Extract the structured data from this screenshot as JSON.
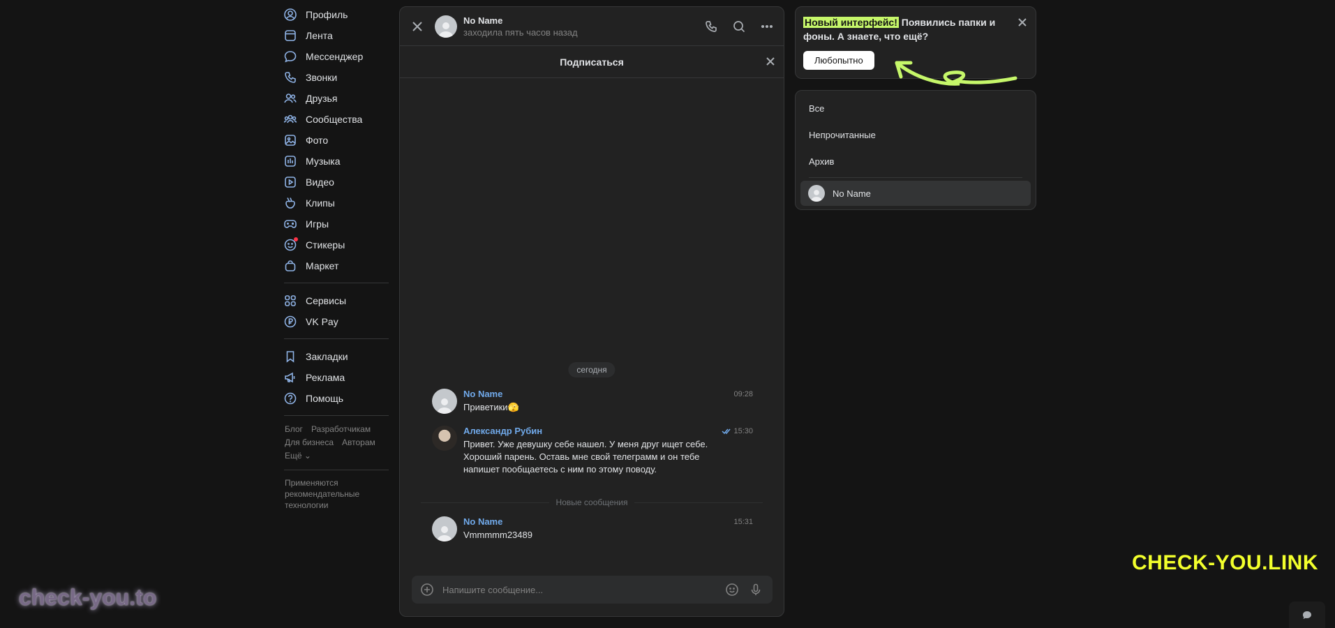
{
  "nav": {
    "primary": [
      {
        "id": "profile",
        "label": "Профиль",
        "icon": "user-circle-icon"
      },
      {
        "id": "feed",
        "label": "Лента",
        "icon": "feed-icon"
      },
      {
        "id": "messenger",
        "label": "Мессенджер",
        "icon": "chat-bubble-icon"
      },
      {
        "id": "calls",
        "label": "Звонки",
        "icon": "phone-icon"
      },
      {
        "id": "friends",
        "label": "Друзья",
        "icon": "friends-icon"
      },
      {
        "id": "communities",
        "label": "Сообщества",
        "icon": "communities-icon"
      },
      {
        "id": "photo",
        "label": "Фото",
        "icon": "photo-icon"
      },
      {
        "id": "music",
        "label": "Музыка",
        "icon": "music-icon"
      },
      {
        "id": "video",
        "label": "Видео",
        "icon": "video-icon"
      },
      {
        "id": "clips",
        "label": "Клипы",
        "icon": "clips-icon"
      },
      {
        "id": "games",
        "label": "Игры",
        "icon": "gamepad-icon"
      },
      {
        "id": "stickers",
        "label": "Стикеры",
        "icon": "sticker-icon"
      },
      {
        "id": "market",
        "label": "Маркет",
        "icon": "shopping-bag-icon"
      }
    ],
    "secondary": [
      {
        "id": "services",
        "label": "Сервисы",
        "icon": "grid-icon"
      },
      {
        "id": "vkpay",
        "label": "VK Pay",
        "icon": "ruble-icon"
      }
    ],
    "tertiary": [
      {
        "id": "bookmarks",
        "label": "Закладки",
        "icon": "bookmark-icon"
      },
      {
        "id": "ads",
        "label": "Реклама",
        "icon": "megaphone-icon"
      },
      {
        "id": "help",
        "label": "Помощь",
        "icon": "question-icon"
      }
    ],
    "footer": {
      "blog": "Блог",
      "developers": "Разработчикам",
      "business": "Для бизнеса",
      "authors": "Авторам",
      "more": "Ещё ⌄"
    },
    "notice": "Применяются рекомендательные технологии"
  },
  "chat": {
    "name": "No Name",
    "status": "заходила пять часов назад",
    "subscribe_label": "Подписаться",
    "date_label": "сегодня",
    "new_messages_label": "Новые сообщения",
    "composer_placeholder": "Напишите сообщение...",
    "messages": [
      {
        "author": "No Name",
        "text": "Приветики🫣",
        "time": "09:28"
      },
      {
        "author": "Александр Рубин",
        "text": "Привет. Уже девушку себе нашел. У меня друг ищет себе. Хороший парень. Оставь мне свой телеграмм и он тебе напишет пообщаетесь с ним по этому поводу.",
        "time": "15:30"
      },
      {
        "author": "No Name",
        "text": "Vmmmmm23489",
        "time": "15:31"
      }
    ]
  },
  "promo": {
    "highlight": "Новый интерфейс!",
    "text": " Появились папки и фоны. А знаете, что ещё?",
    "button": "Любопытно",
    "highlight_color": "#c6f76a"
  },
  "folders": {
    "items": [
      "Все",
      "Непрочитанные",
      "Архив"
    ],
    "chat": "No Name"
  },
  "watermarks": {
    "left": "check-you.to",
    "right": "CHECK-YOU.LINK"
  },
  "colors": {
    "accent": "#71aaeb",
    "background": "#141414",
    "panel": "#222222"
  }
}
